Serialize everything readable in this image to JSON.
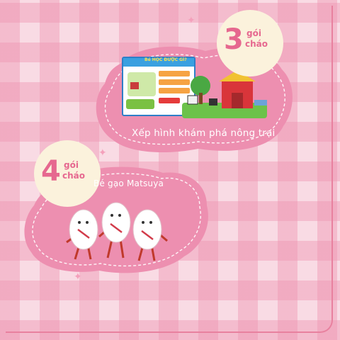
{
  "prize_3": {
    "count": "3",
    "unit_top": "gói",
    "unit_bottom": "cháo",
    "caption": "Xếp hình khám phá nông trại",
    "box_title": "Bé HỌC ĐƯỢC GÌ?"
  },
  "prize_4": {
    "count": "4",
    "unit_top": "gói",
    "unit_bottom": "cháo",
    "caption": "Bé gạo Matsuya"
  },
  "colors": {
    "background": "#f9dbe4",
    "check": "#ee96b2",
    "cloud": "#ed8fb0",
    "number": "#e6688f",
    "badge": "#fbf2dc"
  }
}
